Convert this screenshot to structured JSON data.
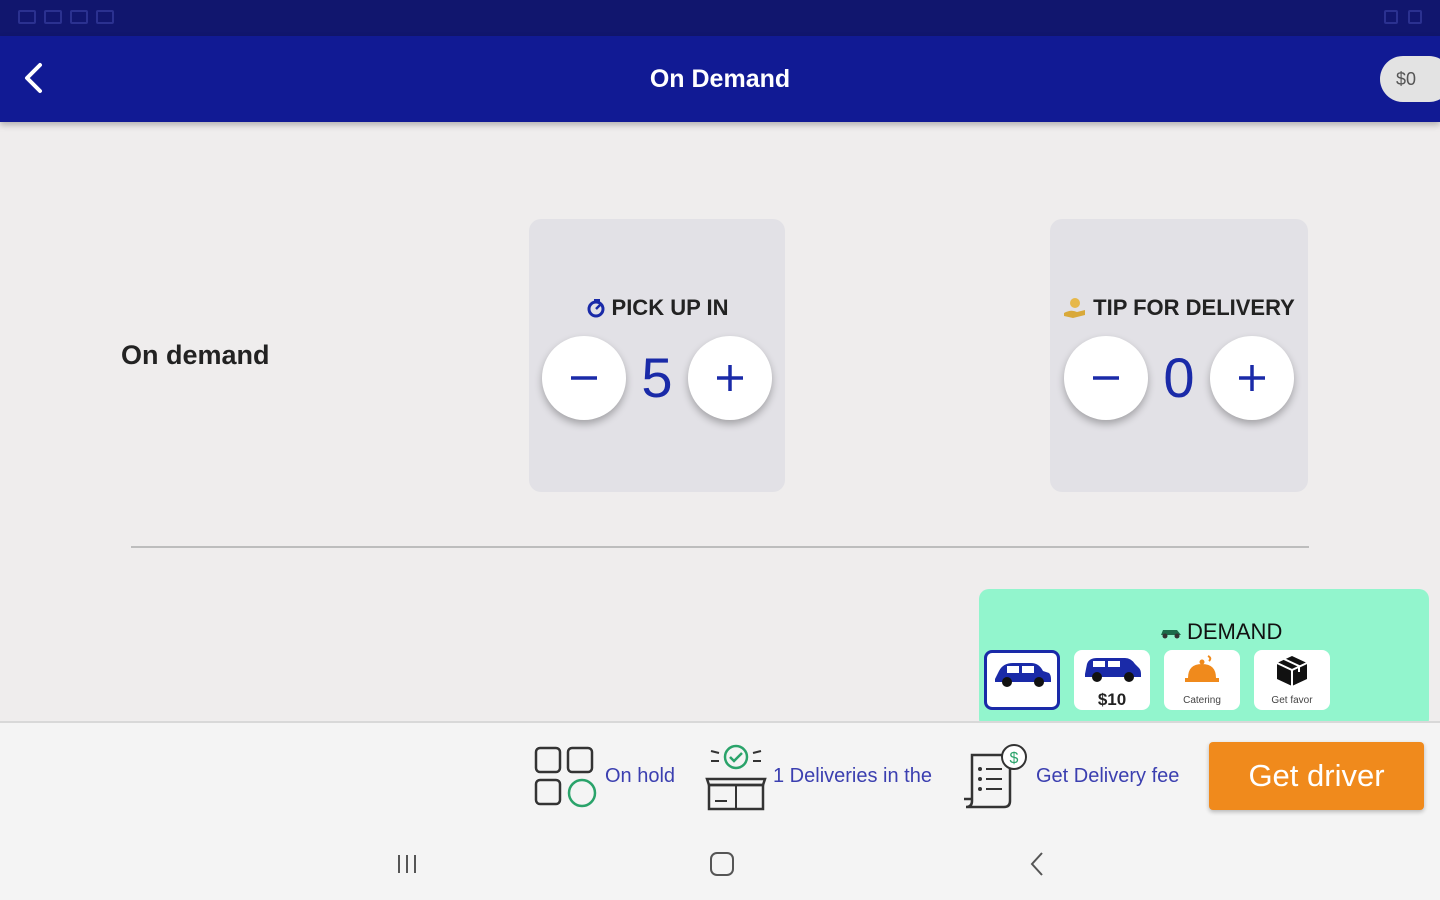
{
  "header": {
    "title": "On Demand",
    "balance": "$0"
  },
  "row": {
    "label": "On demand"
  },
  "pickup": {
    "title": "PICK UP IN",
    "value": "5",
    "icon": "timer-icon"
  },
  "tip": {
    "title": "TIP FOR DELIVERY",
    "value": "0",
    "icon": "hand-coin-icon"
  },
  "demand": {
    "title": "DEMAND",
    "options": [
      {
        "name": "car",
        "price": "",
        "label": ""
      },
      {
        "name": "suv",
        "price": "$10",
        "label": ""
      },
      {
        "name": "catering",
        "price": "",
        "label": "Catering"
      },
      {
        "name": "favor",
        "price": "",
        "label": "Get favor"
      }
    ]
  },
  "bottom": {
    "on_hold": "On hold",
    "deliveries": "1 Deliveries in the",
    "delivery_fee": "Get Delivery fee",
    "get_driver": "Get driver"
  },
  "colors": {
    "app_bar": "#111a94",
    "accent": "#f08a1c",
    "demand_panel": "#92f5cd",
    "value_blue": "#1a2aa8"
  }
}
